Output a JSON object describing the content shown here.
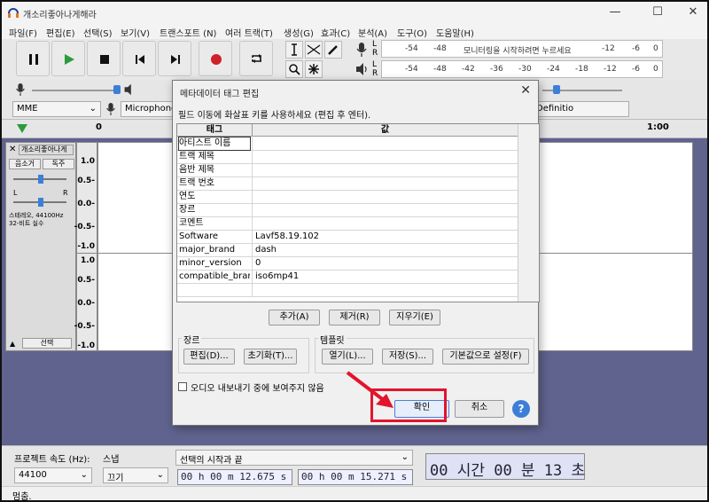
{
  "window": {
    "title": "개소리좋아나게해라",
    "minimize": "—",
    "maximize": "☐",
    "close": "✕"
  },
  "menu": [
    "파일(F)",
    "편집(E)",
    "선택(S)",
    "보기(V)",
    "트랜스포트 (N)",
    "여러 트랙(T)",
    "생성(G)",
    "효과(C)",
    "분석(A)",
    "도구(O)",
    "도움말(H)"
  ],
  "meters": {
    "record_ticks": [
      "-54",
      "-48",
      "모니터링을 시작하려면 누르세요",
      "-12",
      "-6",
      "0"
    ],
    "play_ticks": [
      "-54",
      "-48",
      "-42",
      "-36",
      "-30",
      "-24",
      "-18",
      "-12",
      "-6",
      "0"
    ],
    "lr": [
      "L",
      "R"
    ]
  },
  "device": {
    "host": "MME",
    "input": "Microphone",
    "output": "Definitio"
  },
  "ruler": {
    "marks": [
      "0",
      "1:00"
    ]
  },
  "track": {
    "name": "개소리좋아나게",
    "mute": "음소거",
    "solo": "독주",
    "pan_left": "L",
    "pan_right": "R",
    "info": "스테레오, 44100Hz\n32-비트 실수",
    "select": "선택",
    "vscale_top": [
      "1.0",
      "0.5-",
      "0.0-",
      "-0.5-",
      "-1.0"
    ],
    "vscale_bottom": [
      "1.0",
      "0.5-",
      "0.0-",
      "-0.5-",
      "-1.0"
    ]
  },
  "selection": {
    "rate_label": "프로젝트 속도 (Hz):",
    "rate_value": "44100",
    "snap_label": "스냅",
    "snap_value": "끄기",
    "range_label": "선택의 시작과 끝",
    "start": "00 h 00 m 12.675 s",
    "end": "00 h 00 m 15.271 s",
    "position": "00 시간 00 분 13 초"
  },
  "status": "멈춤.",
  "dialog": {
    "title": "메타데이터 태그 편집",
    "hint": "필드 이동에 화살표 키를 사용하세요 (편집 후 엔터).",
    "col_tag": "태그",
    "col_value": "값",
    "rows": [
      {
        "tag": "아티스트 이름",
        "value": ""
      },
      {
        "tag": "트랙 제목",
        "value": ""
      },
      {
        "tag": "음반 제목",
        "value": ""
      },
      {
        "tag": "트랙 번호",
        "value": ""
      },
      {
        "tag": "연도",
        "value": ""
      },
      {
        "tag": "장르",
        "value": ""
      },
      {
        "tag": "코멘트",
        "value": ""
      },
      {
        "tag": "Software",
        "value": "Lavf58.19.102"
      },
      {
        "tag": "major_brand",
        "value": "dash"
      },
      {
        "tag": "minor_version",
        "value": "0"
      },
      {
        "tag": "compatible_brands",
        "value": "iso6mp41"
      }
    ],
    "add": "추가(A)",
    "remove": "제거(R)",
    "clear": "지우기(E)",
    "genre_group": "장르",
    "genre_edit": "편집(D)...",
    "genre_reset": "초기화(T)...",
    "template_group": "템플릿",
    "template_load": "열기(L)...",
    "template_save": "저장(S)...",
    "template_default": "기본값으로 설정(F)",
    "checkbox_label": "오디오 내보내기 중에 보여주지 않음",
    "ok": "확인",
    "cancel": "취소",
    "help": "?"
  },
  "colors": {
    "accent": "#e2142d",
    "track_bg": "#60638e",
    "play_green": "#2c9a3d",
    "record_red": "#d0202a",
    "help_blue": "#3d7fd8"
  }
}
